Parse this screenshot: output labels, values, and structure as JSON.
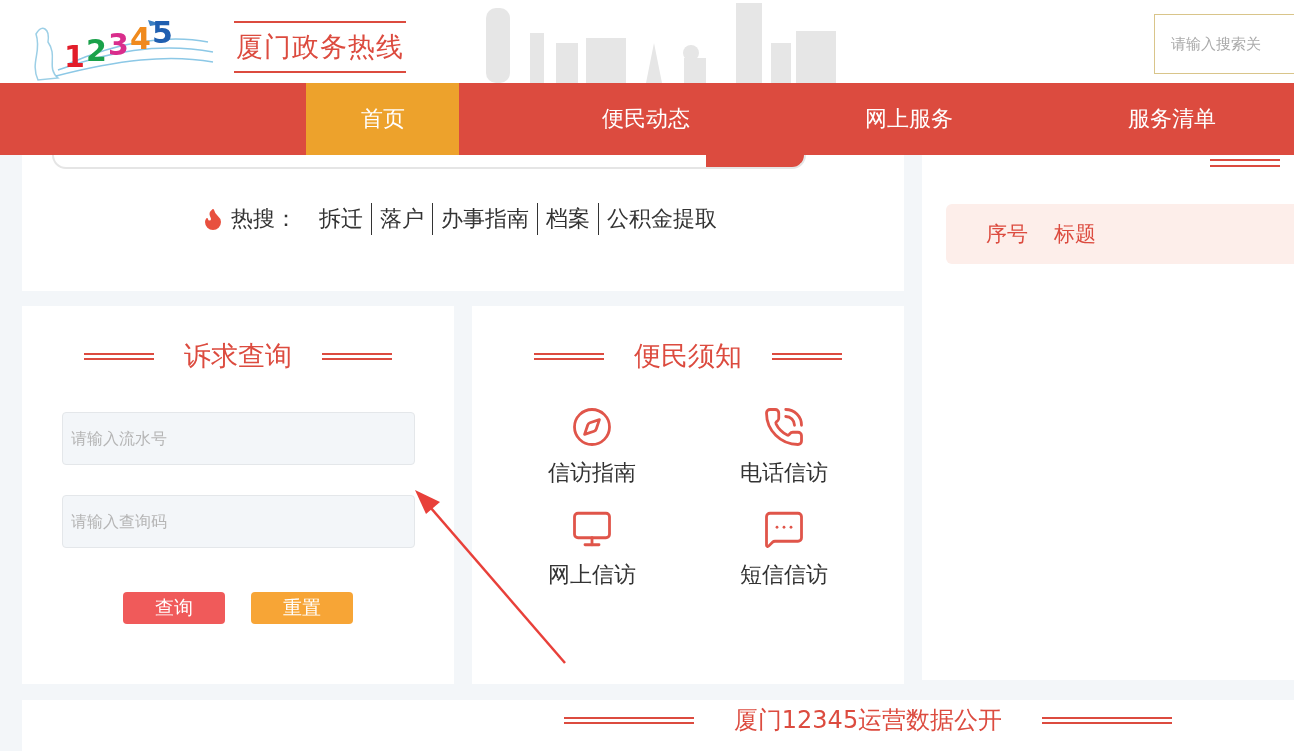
{
  "header": {
    "logo_text": "12345",
    "title": "厦门政务热线",
    "search": {
      "placeholder": "请输入搜索关"
    }
  },
  "nav": [
    {
      "label": "首页",
      "selected": true
    },
    {
      "label": "便民动态",
      "selected": false
    },
    {
      "label": "网上服务",
      "selected": false
    },
    {
      "label": "服务清单",
      "selected": false
    }
  ],
  "hot_search": {
    "label": "热搜：",
    "items": [
      "拆迁",
      "落户",
      "办事指南",
      "档案",
      "公积金提取"
    ]
  },
  "query": {
    "title": "诉求查询",
    "fields": [
      {
        "placeholder": "请输入流水号"
      },
      {
        "placeholder": "请输入查询码"
      }
    ],
    "buttons": [
      {
        "label": "查询",
        "kind": "submit"
      },
      {
        "label": "重置",
        "kind": "reset"
      }
    ]
  },
  "notice": {
    "title": "便民须知",
    "items": [
      {
        "label": "信访指南",
        "kind": "compass"
      },
      {
        "label": "电话信访",
        "kind": "phone"
      },
      {
        "label": "网上信访",
        "kind": "monitor"
      },
      {
        "label": "短信信访",
        "kind": "chat"
      }
    ]
  },
  "list_panel": {
    "columns": [
      "序号",
      "标题"
    ]
  },
  "bottom": {
    "title": "厦门12345运营数据公开"
  }
}
